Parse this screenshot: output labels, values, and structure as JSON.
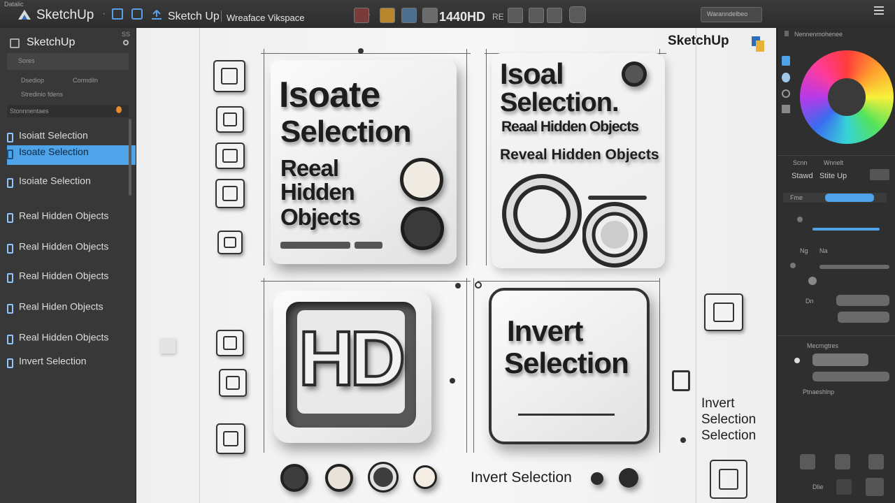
{
  "topbar": {
    "app_name": "SketchUp",
    "file_label": "Sketch Up",
    "workspace_label": "Wreaface Vikspace",
    "resolution_label": "1440HD",
    "resolution_suffix": "RE",
    "menu_small": "Datalic",
    "search_value": "Waranndelbeo"
  },
  "left_panel": {
    "title": "SketchUp",
    "header_code": "SS",
    "rows": [
      "Sores",
      "Dsediop",
      "Cormdiln",
      "Stredinio fdens",
      "Stonnnentaes"
    ],
    "items": [
      {
        "label": "Isoiatt Selection",
        "active": false
      },
      {
        "label": "Isoate Selection",
        "active": true
      },
      {
        "label": "Isoiate Selection",
        "active": false
      },
      {
        "label": "Real Hidden Objects",
        "active": false
      },
      {
        "label": "Real Hidden Objects",
        "active": false
      },
      {
        "label": "Real Hidden Objects",
        "active": false
      },
      {
        "label": "Real Hiden Objects",
        "active": false
      },
      {
        "label": "Real Hidden Objects",
        "active": false
      },
      {
        "label": "Invert Selection",
        "active": false
      }
    ]
  },
  "canvas": {
    "brand": "SketchUp",
    "card1": {
      "line1": "Isoate",
      "line2": "Selection",
      "line3": "Reeal",
      "line4": "Hidden",
      "line5": "Objects"
    },
    "card2": {
      "line1": "Isoal",
      "line2": "Selection.",
      "line3": "Reaal Hidden Objects",
      "line4": "Reveal Hidden Objects"
    },
    "card3": {
      "line1": "HD"
    },
    "card4": {
      "line1": "Invert",
      "line2": "Selection"
    },
    "side_text": {
      "line1": "Invert",
      "line2": "Selection",
      "line3": "Selection"
    },
    "bottom_text": "Invert Selection"
  },
  "right_panel": {
    "title": "Nennenmohenee",
    "labels": [
      "Scnn",
      "Wnnelt",
      "Stawd",
      "Stite Up",
      "Fme",
      "Ng",
      "Na",
      "Dn",
      "Mecrngtres",
      "Ptnaeshlnp",
      "Dlie"
    ],
    "colors": {
      "accent": "#4fa3e8",
      "wheel_center": "#3a3a3a"
    }
  }
}
